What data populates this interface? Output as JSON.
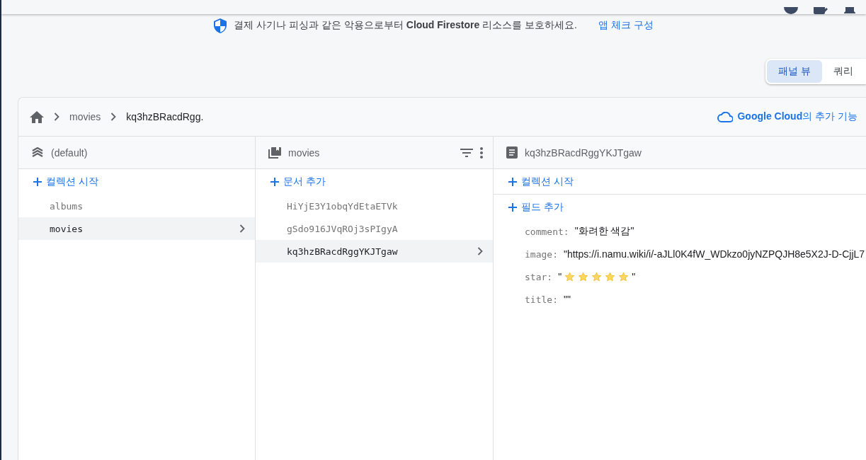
{
  "banner": {
    "text": "결제 사기나 피싱과 같은 악용으로부터 **Cloud Firestore** 리소스를 보호하세요.",
    "link": "앱 체크 구성"
  },
  "view_toggle": [
    {
      "label": "패널 뷰",
      "selected": true
    },
    {
      "label": "쿼리",
      "selected": false
    }
  ],
  "breadcrumb": [
    "movies",
    "kq3hzBRacdRgg."
  ],
  "cloud_link": "**Google Cloud**의 추가 기능",
  "panels": [
    {
      "kind": "database",
      "title": "(default)",
      "actions": [
        "컬렉션 시작"
      ],
      "items": [
        {
          "label": "albums",
          "selected": false
        },
        {
          "label": "movies",
          "selected": true
        }
      ]
    },
    {
      "kind": "collection",
      "title": "movies",
      "actions": [
        "문서 추가"
      ],
      "items": [
        {
          "label": "HiYjE3Y1obqYdEtaETVk",
          "selected": false
        },
        {
          "label": "gSdo916JVqROj3sPIgyA",
          "selected": false
        },
        {
          "label": "kq3hzBRacdRggYKJTgaw",
          "selected": true
        }
      ]
    },
    {
      "kind": "document",
      "title": "kq3hzBRacdRggYKJTgaw",
      "actions": [
        "컬렉션 시작",
        "필드 추가"
      ],
      "fields": [
        {
          "kind": "text",
          "key": "comment:",
          "value": "\"화려한 색감\""
        },
        {
          "kind": "text",
          "key": "image:",
          "value": "\"https://i.namu.wiki/i/-aJLl0K4fW_WDkzo0jyNZPQJH8e5X2J-D-CjjL7"
        },
        {
          "kind": "stars",
          "key": "star:",
          "open_quote": "\"",
          "stars": 5,
          "close_quote": "\""
        },
        {
          "kind": "text",
          "key": "title:",
          "value": "\"\""
        }
      ]
    }
  ]
}
